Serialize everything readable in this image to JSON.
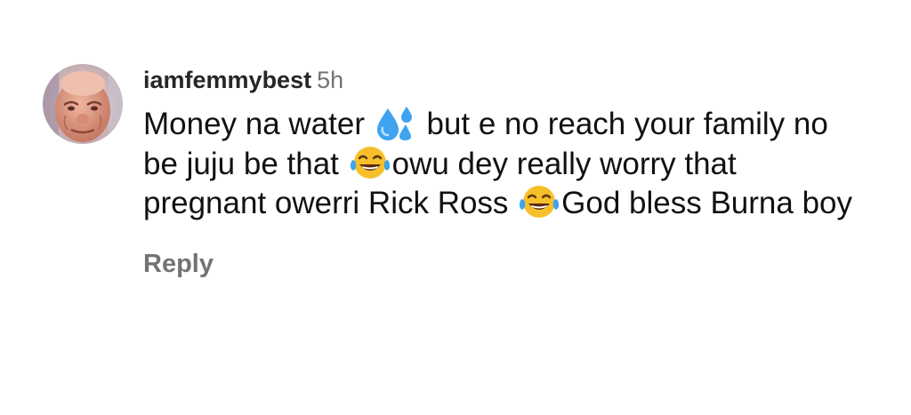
{
  "comment": {
    "username": "iamfemmybest",
    "time": "5h",
    "text_parts": [
      "Money na water ",
      " but e no reach your family no be juju be that ",
      "owu dey really worry that pregnant owerri Rick Ross ",
      "God bless Burna boy"
    ],
    "emojis": [
      "sweat-droplets-icon",
      "tears-of-joy-icon",
      "tears-of-joy-icon"
    ],
    "reply_label": "Reply"
  },
  "colors": {
    "username": "#262626",
    "meta": "#737373",
    "text": "#111111",
    "emoji_face": "#f7c02b",
    "droplet": "#3fa3f0"
  }
}
